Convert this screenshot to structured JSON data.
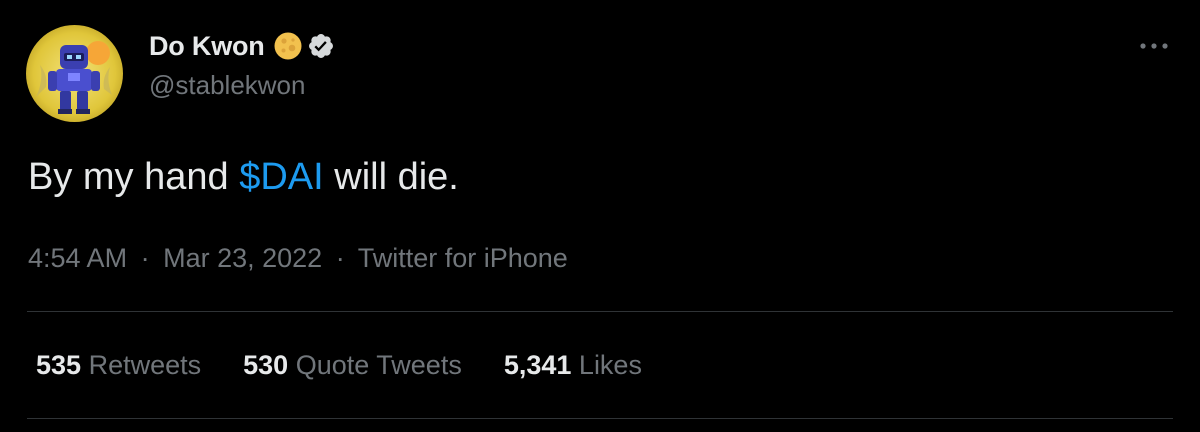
{
  "colors": {
    "background": "#000000",
    "primary_text": "#e7e9ea",
    "secondary_text": "#71767b",
    "link": "#1d9bf0",
    "divider": "#2f3336"
  },
  "author": {
    "display_name": "Do Kwon",
    "handle": "@stablekwon",
    "avatar_icon": "robot-avatar-icon",
    "badges": [
      "moon-emoji-icon",
      "verified-badge-icon"
    ]
  },
  "tweet": {
    "text_before": "By my hand ",
    "cashtag": "$DAI",
    "text_after": " will die."
  },
  "meta": {
    "time": "4:54 AM",
    "separator": "·",
    "date": "Mar 23, 2022",
    "source": "Twitter for iPhone"
  },
  "stats": [
    {
      "count": "535",
      "label": "Retweets"
    },
    {
      "count": "530",
      "label": "Quote Tweets"
    },
    {
      "count": "5,341",
      "label": "Likes"
    }
  ],
  "more_icon": "more-options-icon"
}
